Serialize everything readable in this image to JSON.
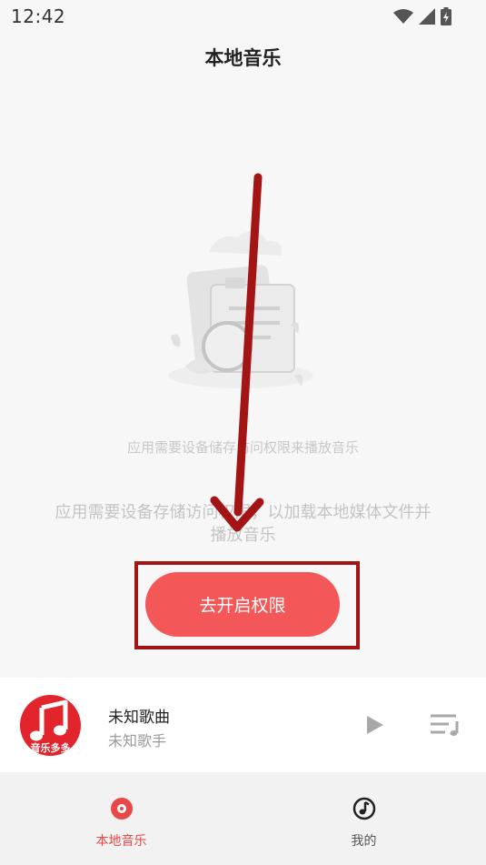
{
  "status_bar": {
    "time": "12:42",
    "icons": [
      "wifi-icon",
      "signal-icon",
      "battery-icon"
    ]
  },
  "header": {
    "title": "本地音乐"
  },
  "empty_state": {
    "illustration": "empty-document-icon",
    "hint": "应用需要设备储存访问权限来播放音乐",
    "description": "应用需要设备存储访问权限，以加载本地媒体文件并播放音乐",
    "grant_button_label": "去开启权限"
  },
  "player": {
    "album_logo_text": "音乐多多",
    "song_title": "未知歌曲",
    "artist": "未知歌手",
    "play_icon": "play-icon",
    "playlist_icon": "playlist-icon"
  },
  "tabs": [
    {
      "label": "本地音乐",
      "icon": "disc-icon",
      "active": true
    },
    {
      "label": "我的",
      "icon": "music-note-circle-icon",
      "active": false
    }
  ],
  "colors": {
    "accent": "#f45757",
    "annotation": "#a31414",
    "tab_active": "#e84848",
    "album": "#e2242d"
  }
}
